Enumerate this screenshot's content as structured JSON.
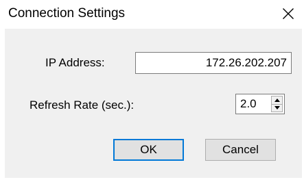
{
  "window": {
    "title": "Connection Settings",
    "close_icon": "close-icon"
  },
  "form": {
    "ip_label": "IP Address:",
    "ip_value": "172.26.202.207",
    "refresh_label": "Refresh Rate (sec.):",
    "refresh_value": "2.0",
    "spin_up_icon": "chevron-up-icon",
    "spin_down_icon": "chevron-down-icon"
  },
  "buttons": {
    "ok_label": "OK",
    "cancel_label": "Cancel"
  },
  "colors": {
    "client_background": "#f0f0f0",
    "button_face": "#e1e1e1",
    "default_button_border": "#0078d7",
    "input_border": "#7a7a7a"
  }
}
